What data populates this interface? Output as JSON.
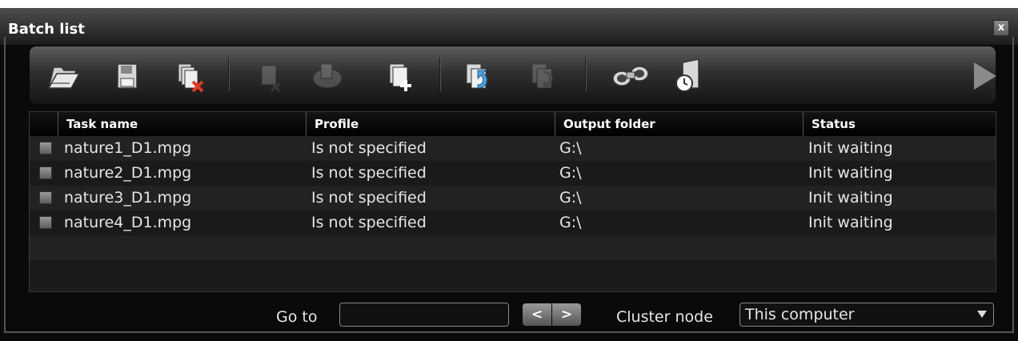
{
  "window": {
    "title": "Batch list",
    "close_label": "x"
  },
  "toolbar": {
    "icons": [
      {
        "name": "open-folder-icon",
        "enabled": true
      },
      {
        "name": "save-disk-icon",
        "enabled": true
      },
      {
        "name": "delete-all-icon",
        "enabled": true
      },
      {
        "name": "remove-task-icon",
        "enabled": false
      },
      {
        "name": "reset-task-icon",
        "enabled": false
      },
      {
        "name": "add-task-icon",
        "enabled": true
      },
      {
        "name": "move-up-icon",
        "enabled": true
      },
      {
        "name": "move-down-icon",
        "enabled": false
      },
      {
        "name": "find-binoculars-icon",
        "enabled": true
      },
      {
        "name": "schedule-exit-icon",
        "enabled": true
      },
      {
        "name": "play-icon",
        "enabled": false
      }
    ]
  },
  "grid": {
    "columns": [
      "Task name",
      "Profile",
      "Output folder",
      "Status"
    ],
    "rows": [
      {
        "task": "nature1_D1.mpg",
        "profile": "Is not specified",
        "output": "G:\\",
        "status": "Init waiting"
      },
      {
        "task": "nature2_D1.mpg",
        "profile": "Is not specified",
        "output": "G:\\",
        "status": "Init waiting"
      },
      {
        "task": "nature3_D1.mpg",
        "profile": "Is not specified",
        "output": "G:\\",
        "status": "Init waiting"
      },
      {
        "task": "nature4_D1.mpg",
        "profile": "Is not specified",
        "output": "G:\\",
        "status": "Init waiting"
      }
    ]
  },
  "footer": {
    "goto_label": "Go to",
    "goto_value": "",
    "prev_label": "<",
    "next_label": ">",
    "cluster_label": "Cluster node",
    "cluster_value": "This computer"
  }
}
